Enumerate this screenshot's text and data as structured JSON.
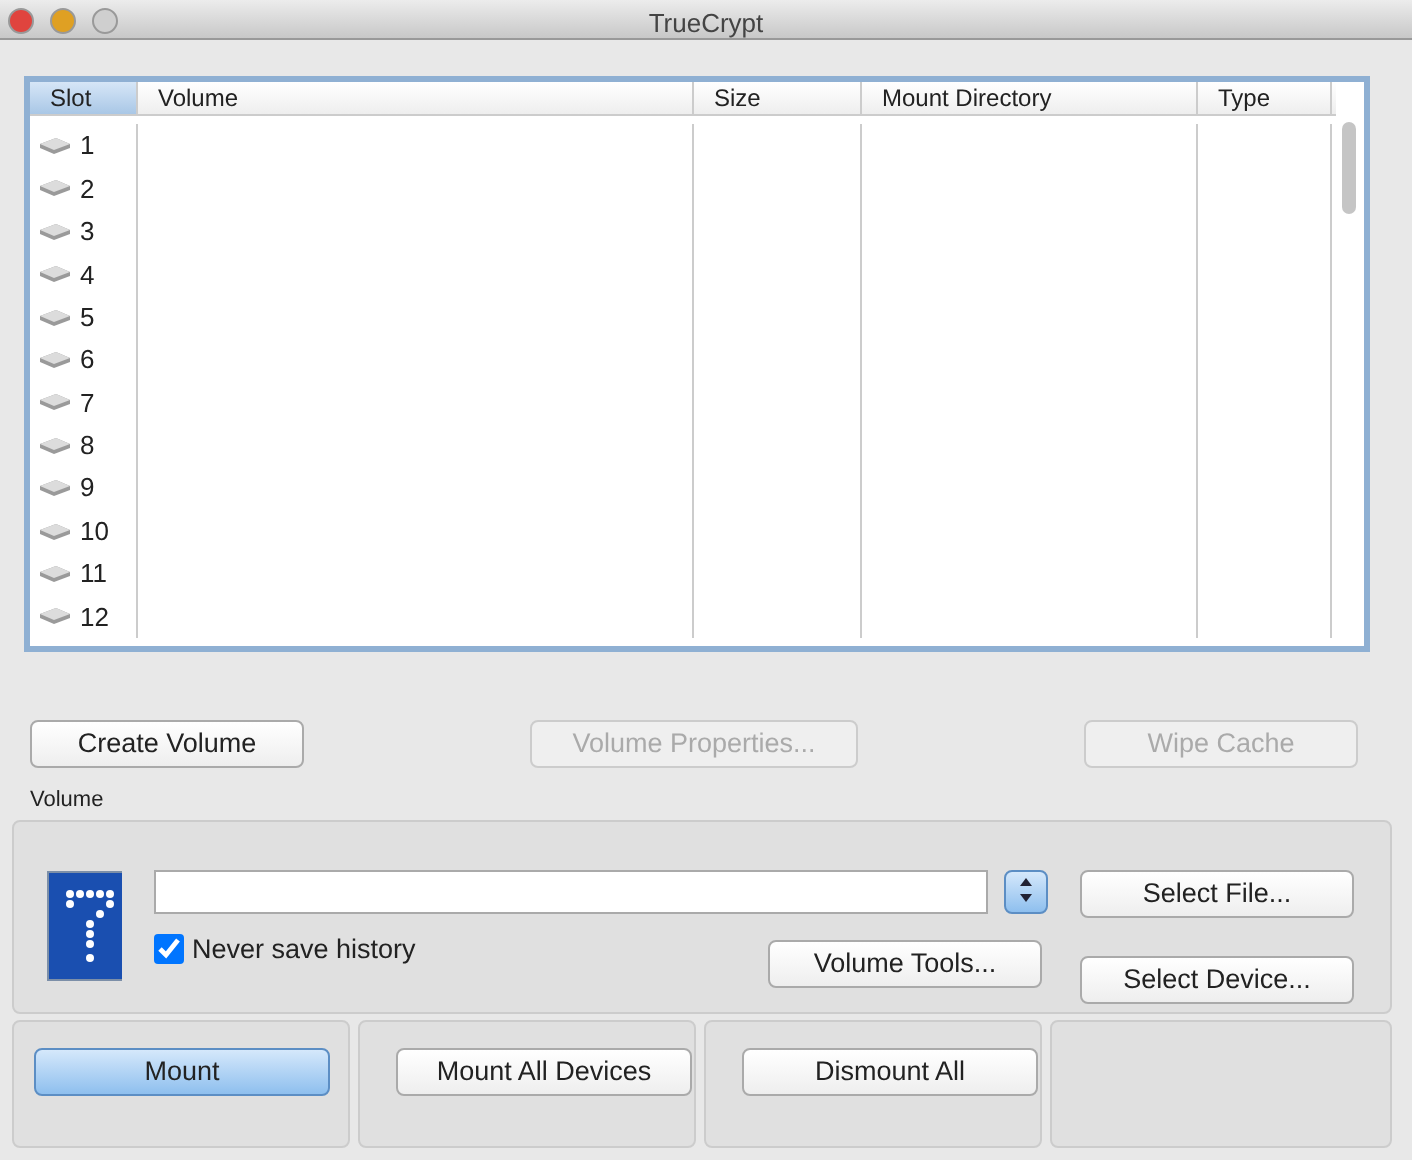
{
  "window": {
    "title": "TrueCrypt"
  },
  "table": {
    "columns": [
      {
        "label": "Slot",
        "sorted": true
      },
      {
        "label": "Volume",
        "sorted": false
      },
      {
        "label": "Size",
        "sorted": false
      },
      {
        "label": "Mount Directory",
        "sorted": false
      },
      {
        "label": "Type",
        "sorted": false
      }
    ],
    "rows": [
      {
        "slot": "1"
      },
      {
        "slot": "2"
      },
      {
        "slot": "3"
      },
      {
        "slot": "4"
      },
      {
        "slot": "5"
      },
      {
        "slot": "6"
      },
      {
        "slot": "7"
      },
      {
        "slot": "8"
      },
      {
        "slot": "9"
      },
      {
        "slot": "10"
      },
      {
        "slot": "11"
      },
      {
        "slot": "12"
      }
    ]
  },
  "actions": [
    {
      "label": "Create Volume",
      "disabled": false
    },
    {
      "label": "Volume Properties...",
      "disabled": true
    },
    {
      "label": "Wipe Cache",
      "disabled": true
    }
  ],
  "volume": {
    "label": "Volume",
    "never_save_history": {
      "label": "Never save history",
      "checked": true
    },
    "buttons": [
      {
        "label": "Select File...",
        "disabled": false
      },
      {
        "label": "Volume Tools...",
        "disabled": false
      },
      {
        "label": "Select Device...",
        "disabled": false
      }
    ]
  },
  "bottom_buttons": [
    {
      "label": "Mount",
      "default": true
    },
    {
      "label": "Mount All Devices",
      "default": false
    },
    {
      "label": "Dismount All",
      "default": false
    }
  ]
}
